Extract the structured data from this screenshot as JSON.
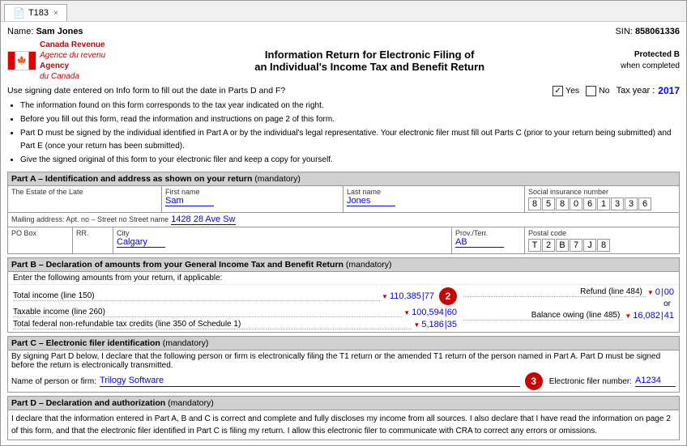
{
  "tab": {
    "icon": "📄",
    "label": "T183",
    "close": "×"
  },
  "header": {
    "name_label": "Name:",
    "name_value": "Sam Jones",
    "sin_label": "SIN:",
    "sin_value": "858061336",
    "agency_en": "Canada Revenue",
    "agency_fr_line1": "Agence du revenu",
    "agency_en2": "Agency",
    "agency_fr_line2": "du Canada",
    "title_line1": "Information Return for Electronic Filing of",
    "title_line2": "an Individual's Income Tax and Benefit Return",
    "protected": "Protected B",
    "when_completed": "when completed",
    "signing_text": "Use signing date entered on Info form to fill out the date in Parts D and F?",
    "yes_label": "Yes",
    "no_label": "No",
    "tax_year_label": "Tax year :",
    "tax_year_value": "2017"
  },
  "bullets": [
    "The information found on this form corresponds to the tax year indicated on the right.",
    "Before you fill out this form, read the information and instructions on page 2 of this form.",
    "Part D must be signed by the individual identified in Part A or by the individual's legal representative. Your electronic filer must fill out Parts C (prior to your return being submitted) and Part E (once your return has been submitted).",
    "Give the signed original of this form to your electronic filer and keep a copy for yourself."
  ],
  "part_a": {
    "header": "Part A – Identification and address as shown on your return",
    "mandatory": "(mandatory)",
    "estate_label": "The Estate of the Late",
    "first_name_label": "First name",
    "first_name_value": "Sam",
    "last_name_label": "Last name",
    "last_name_value": "Jones",
    "sin_label": "Social insurance number",
    "sin_digits": [
      "8",
      "5",
      "8",
      "0",
      "6",
      "1",
      "3",
      "3",
      "6"
    ],
    "mailing_label": "Mailing address: Apt. no – Street no Street name",
    "mailing_value": "1428 28 Ave Sw",
    "pobox_label": "PO Box",
    "rr_label": "RR.",
    "city_label": "City",
    "city_value": "Calgary",
    "prov_label": "Prov./Terr.",
    "prov_value": "AB",
    "postal_label": "Postal code",
    "postal_digits": [
      "T",
      "2",
      "B",
      "7",
      "J",
      "8"
    ]
  },
  "part_b": {
    "header": "Part B – Declaration of amounts from your General Income Tax and Benefit Return",
    "mandatory": "(mandatory)",
    "intro": "Enter the following amounts from your return, if applicable:",
    "total_income_label": "Total income (line 150)",
    "total_income_main": "110,385",
    "total_income_dec": "77",
    "taxable_income_label": "Taxable income (line 260)",
    "taxable_income_main": "100,594",
    "taxable_income_dec": "60",
    "credits_label": "Total federal non-refundable tax credits (line 350 of Schedule 1)",
    "credits_main": "5,186",
    "credits_dec": "35",
    "refund_label": "Refund (line 484)",
    "refund_main": "0",
    "refund_dec": "00",
    "or_text": "or",
    "balance_label": "Balance owing (line 485)",
    "balance_main": "16,082",
    "balance_dec": "41",
    "badge_2": "2"
  },
  "part_c": {
    "header": "Part C – Electronic filer identification",
    "mandatory": "(mandatory)",
    "body_text": "By signing Part D below, I declare that the following person or firm is electronically filing the T1 return or the amended T1 return of the person named in Part A. Part D must be signed before the return is electronically transmitted.",
    "firm_label": "Name of person or firm:",
    "firm_value": "Trilogy Software",
    "efiler_label": "Electronic filer number:",
    "efiler_value": "A1234",
    "badge_3": "3"
  },
  "part_d": {
    "header": "Part D – Declaration and authorization",
    "mandatory": "(mandatory)",
    "body_text": "I declare that the information entered in Part A, B and C is correct and complete and fully discloses my income from all sources. I also declare that I have read the information on page 2 of this form, and that the electronic filer identified in Part C is filing my return. I allow this electronic filer to communicate with CRA to correct any errors or omissions."
  }
}
